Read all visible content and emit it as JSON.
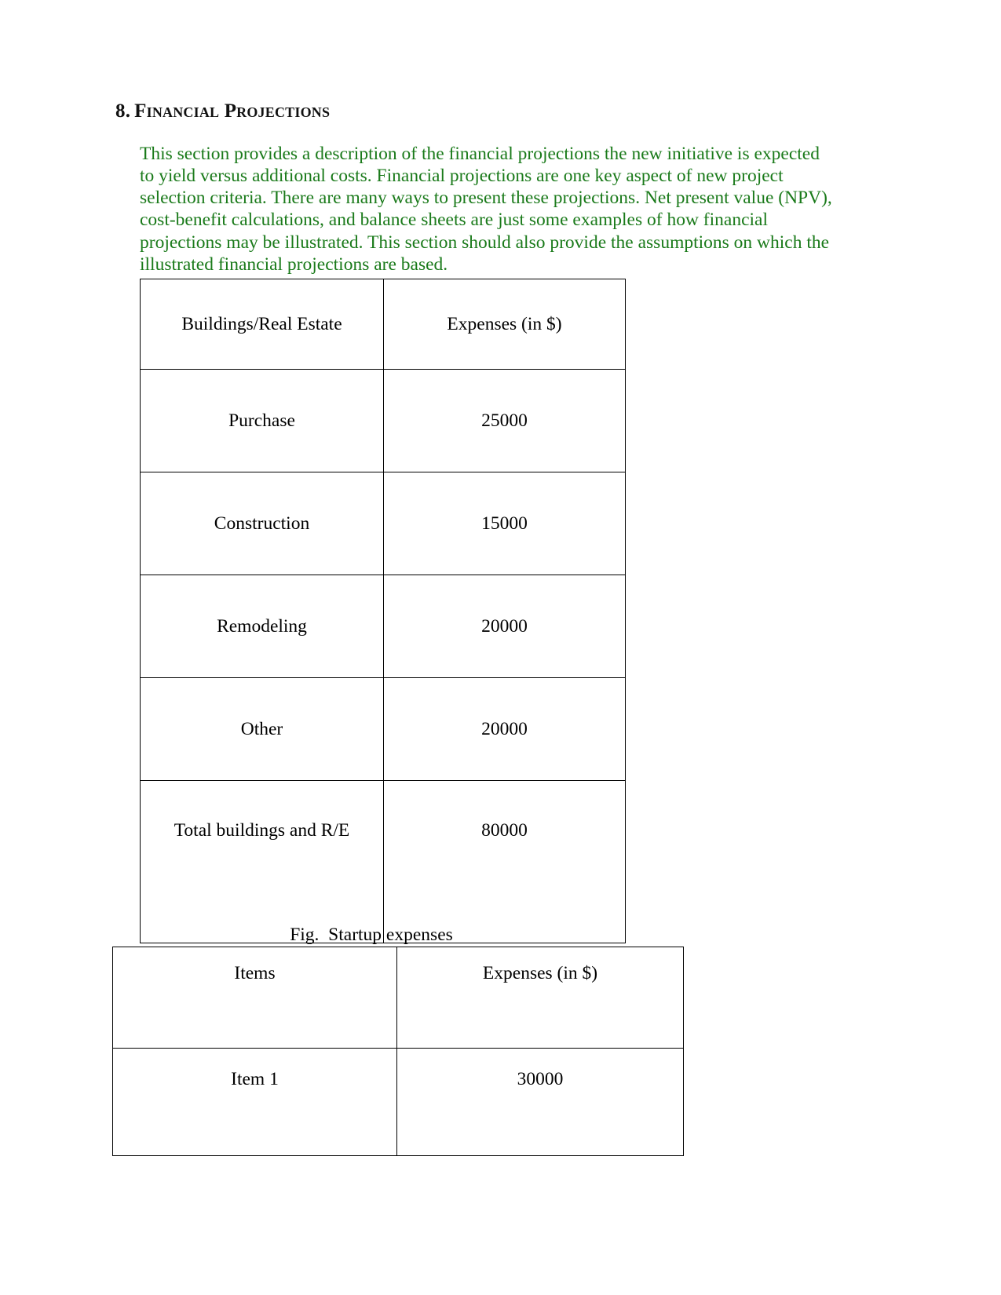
{
  "heading": {
    "number": "8.",
    "title": "Financial Projections"
  },
  "body": {
    "paragraph": "This section provides a description of the financial projections the new initiative is expected to yield versus additional costs. Financial projections are one key aspect of new project selection criteria. There are many ways to present these projections. Net present value (NPV), cost-benefit calculations, and balance sheets are just some examples of how financial projections may be illustrated. This section should also provide the assumptions on which the illustrated financial projections are based."
  },
  "table_startup_expenses": {
    "headers": [
      "Buildings/Real Estate",
      "Expenses (in $)"
    ],
    "rows": [
      {
        "label": "Purchase",
        "value": "25000"
      },
      {
        "label": "Construction",
        "value": "15000"
      },
      {
        "label": "Remodeling",
        "value": "20000"
      },
      {
        "label": "Other",
        "value": "20000"
      },
      {
        "label": "Total buildings and R/E",
        "value": "80000"
      }
    ]
  },
  "figure_caption": "Fig.  Startup expenses",
  "table_items_expenses": {
    "headers": [
      "Items",
      "Expenses (in $)"
    ],
    "rows": [
      {
        "label": "Item 1",
        "value": "30000"
      }
    ]
  },
  "colors": {
    "body_text_green": "#1a7a1a",
    "heading_black": "#111111",
    "table_border": "#000000",
    "page_background": "#ffffff"
  }
}
